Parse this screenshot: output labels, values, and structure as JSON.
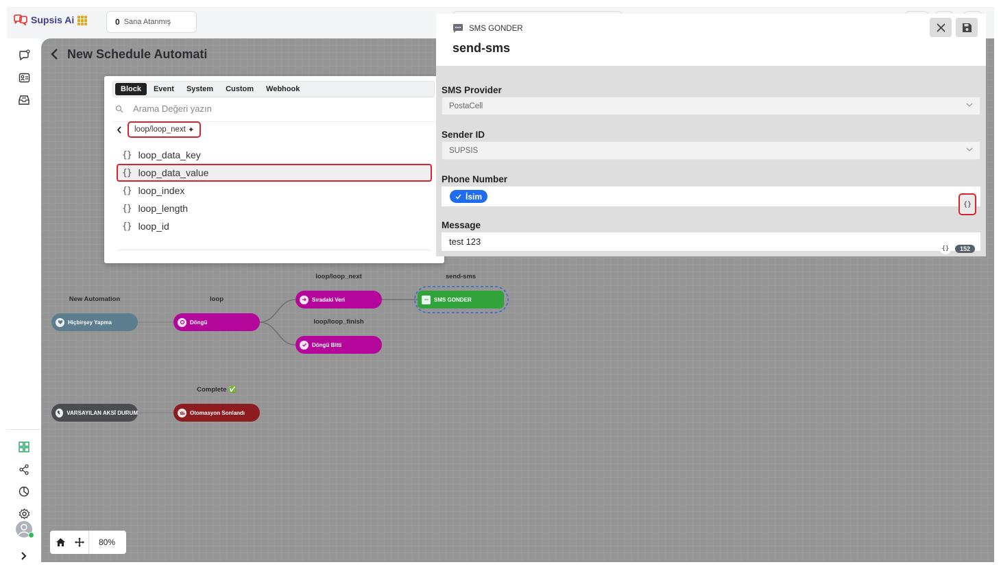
{
  "app": {
    "brand": "Supsis Ai"
  },
  "topbar": {
    "assign_count": "0",
    "assign_label": "Sana Atanmış"
  },
  "page": {
    "title": "New Schedule Automati"
  },
  "popup": {
    "tabs": [
      "Block",
      "Event",
      "System",
      "Custom",
      "Webhook"
    ],
    "active_tab": "Block",
    "search_placeholder": "Arama Değeri yazın",
    "breadcrumb": "loop/loop_next",
    "variables": [
      "loop_data_key",
      "loop_data_value",
      "loop_index",
      "loop_length",
      "loop_id"
    ],
    "selected_variable": "loop_data_value"
  },
  "panel": {
    "type_label": "SMS GONDER",
    "title": "send-sms",
    "fields": {
      "provider_label": "SMS Provider",
      "provider_value": "PostaCell",
      "sender_label": "Sender ID",
      "sender_value": "SUPSIS",
      "phone_label": "Phone Number",
      "phone_chip": "İsim",
      "message_label": "Message",
      "message_value": "test 123",
      "message_count": "152"
    }
  },
  "flow": {
    "labels": {
      "new_automation": "New Automation",
      "loop": "loop",
      "loop_next": "loop/loop_next",
      "loop_finish": "loop/loop_finish",
      "send_sms": "send-sms",
      "complete": "Complete ✅"
    },
    "nodes": {
      "hicbirsey": "Hiçbirşey Yapma",
      "dongu": "Döngü",
      "siradaki": "Sıradaki Veri",
      "dongu_bitti": "Döngü Bitti",
      "sms": "SMS GONDER",
      "varsayilan": "VARSAYILAN AKSİ DURUM",
      "otomasyon": "Otomasyon Sonlandı"
    }
  },
  "zoom": {
    "level": "80%"
  },
  "colors": {
    "accent_red": "#d6262d",
    "node_slate": "#5b7d8e",
    "node_magenta": "#b5069c",
    "node_green": "#30a33a",
    "node_dark": "#4a4c52",
    "node_maroon": "#8e1b1f",
    "chip_blue": "#1e6cf0"
  }
}
